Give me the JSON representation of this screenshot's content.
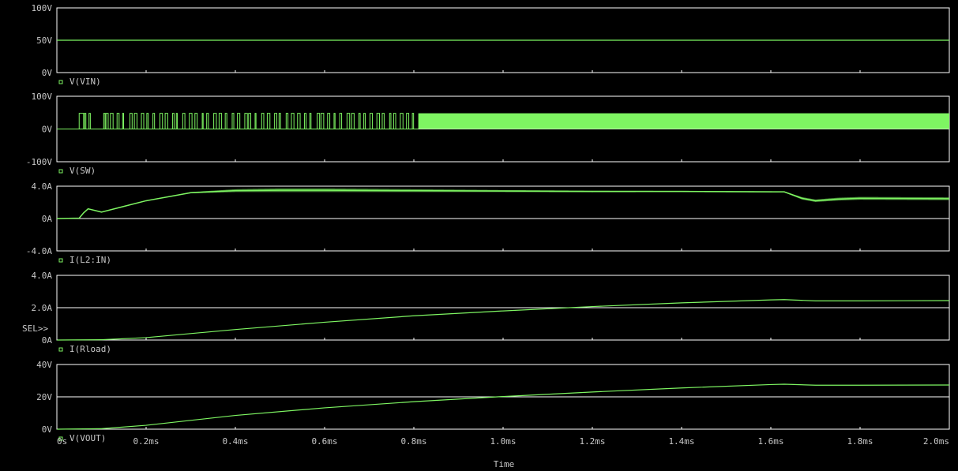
{
  "colors": {
    "background": "#000000",
    "grid": "#ffffff",
    "trace": "#7ef562",
    "text": "#c8c8c8"
  },
  "x_axis": {
    "label": "Time",
    "unit": "ms",
    "range": [
      0,
      2.0
    ],
    "ticks": [
      0,
      0.2,
      0.4,
      0.6,
      0.8,
      1.0,
      1.2,
      1.4,
      1.6,
      1.8,
      2.0
    ],
    "tick_labels": [
      "0s",
      "0.2ms",
      "0.4ms",
      "0.6ms",
      "0.8ms",
      "1.0ms",
      "1.2ms",
      "1.4ms",
      "1.6ms",
      "1.8ms",
      "2.0ms"
    ]
  },
  "selection_marker": "SEL>>",
  "chart_data": [
    {
      "type": "line",
      "legend": "V(VIN)",
      "y_ticks": [
        0,
        50,
        100
      ],
      "y_tick_labels": [
        "0V",
        "50V",
        "100V"
      ],
      "ylim": [
        0,
        100
      ],
      "grid": true,
      "x": [
        0,
        2.0
      ],
      "y": [
        50,
        50
      ]
    },
    {
      "type": "line",
      "legend": "V(SW)",
      "y_ticks": [
        -100,
        0,
        100
      ],
      "y_tick_labels": [
        "-100V",
        "0V",
        "100V"
      ],
      "ylim": [
        -100,
        100
      ],
      "grid": true,
      "switching": {
        "low": 0,
        "high": 48,
        "first_switch_ms": 0.05,
        "sparse_until_ms": 0.81
      },
      "x": [
        0,
        0.05,
        0.81,
        2.0
      ],
      "y": [
        0,
        48,
        48,
        48
      ]
    },
    {
      "type": "line",
      "legend": "I(L2:IN)",
      "y_ticks": [
        -4,
        0,
        4
      ],
      "y_tick_labels": [
        "-4.0A",
        "0A",
        "4.0A"
      ],
      "ylim": [
        -4,
        4
      ],
      "grid": true,
      "x": [
        0,
        0.05,
        0.06,
        0.07,
        0.1,
        0.15,
        0.2,
        0.25,
        0.3,
        0.4,
        0.5,
        0.6,
        0.8,
        1.0,
        1.2,
        1.4,
        1.6,
        1.63,
        1.67,
        1.7,
        1.75,
        1.8,
        2.0
      ],
      "y": [
        0,
        0.05,
        0.7,
        1.2,
        0.8,
        1.5,
        2.2,
        2.7,
        3.2,
        3.45,
        3.5,
        3.5,
        3.45,
        3.4,
        3.35,
        3.35,
        3.3,
        3.3,
        2.5,
        2.2,
        2.4,
        2.5,
        2.45
      ],
      "ripple": [
        0,
        0,
        0,
        0,
        0,
        0,
        0,
        0,
        0.15,
        0.35,
        0.45,
        0.45,
        0.35,
        0.25,
        0.2,
        0.15,
        0.15,
        0.1,
        0.3,
        0.3,
        0.35,
        0.35,
        0.35
      ]
    },
    {
      "type": "line",
      "legend": "I(Rload)",
      "y_ticks": [
        0,
        2,
        4
      ],
      "y_tick_labels": [
        "0A",
        "2.0A",
        "4.0A"
      ],
      "ylim": [
        0,
        4
      ],
      "grid": true,
      "x": [
        0,
        0.1,
        0.2,
        0.4,
        0.6,
        0.8,
        1.0,
        1.2,
        1.4,
        1.6,
        1.63,
        1.7,
        1.8,
        2.0
      ],
      "y": [
        0,
        0.02,
        0.15,
        0.65,
        1.1,
        1.5,
        1.8,
        2.07,
        2.3,
        2.48,
        2.5,
        2.42,
        2.42,
        2.44
      ]
    },
    {
      "type": "line",
      "legend": "V(VOUT)",
      "y_ticks": [
        0,
        20,
        40
      ],
      "y_tick_labels": [
        "0V",
        "20V",
        "40V"
      ],
      "ylim": [
        0,
        40
      ],
      "grid": true,
      "x": [
        0,
        0.1,
        0.2,
        0.4,
        0.6,
        0.8,
        1.0,
        1.2,
        1.4,
        1.6,
        1.63,
        1.7,
        1.8,
        2.0
      ],
      "y": [
        0,
        0.3,
        2.4,
        8.5,
        13.2,
        17.0,
        20.2,
        23.0,
        25.5,
        27.6,
        27.8,
        27.2,
        27.2,
        27.3
      ]
    }
  ]
}
